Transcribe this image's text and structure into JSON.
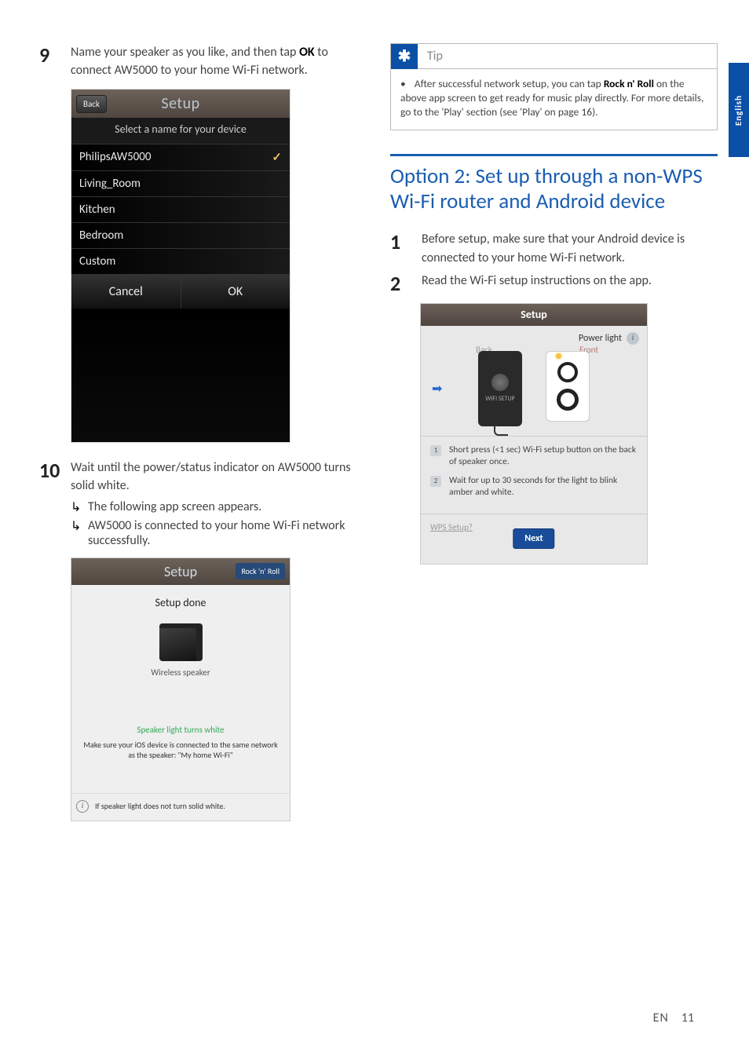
{
  "langTab": "English",
  "footer": {
    "lang": "EN",
    "page": "11"
  },
  "left": {
    "step9": {
      "num": "9",
      "text_a": "Name your speaker as you like, and then tap ",
      "text_bold": "OK",
      "text_b": " to connect AW5000 to your home Wi-Fi network."
    },
    "mock1": {
      "back": "Back",
      "title": "Setup",
      "subhead": "Select a name for your device",
      "rows": [
        "PhilipsAW5000",
        "Living_Room",
        "Kitchen",
        "Bedroom",
        "Custom"
      ],
      "checked_index": 0,
      "cancel": "Cancel",
      "ok": "OK"
    },
    "step10": {
      "num": "10",
      "text": "Wait until the power/status indicator on AW5000 turns solid white.",
      "sub1": "The following app screen appears.",
      "sub2": "AW5000 is connected to your home Wi-Fi network successfully."
    },
    "mock2": {
      "title": "Setup",
      "roll": "Rock 'n' Roll",
      "done": "Setup done",
      "label": "Wireless speaker",
      "white": "Speaker light turns white",
      "note": "Make sure your iOS device is connected to the same network as the speaker:  \"My home Wi-Fi\"",
      "info": "If speaker light does not turn solid white."
    }
  },
  "right": {
    "tip": {
      "label": "Tip",
      "body_a": "After successful network setup, you can tap ",
      "body_bold": "Rock n' Roll",
      "body_b": " on the above app screen to get ready for music play directly. For more details, go to the 'Play' section (see 'Play' on page 16)."
    },
    "heading": "Option 2: Set up through a non-WPS Wi-Fi router and Android device",
    "step1": {
      "num": "1",
      "text": "Before setup, make sure that your Android device is connected to your home Wi-Fi network."
    },
    "step2": {
      "num": "2",
      "text": "Read the Wi-Fi setup instructions on the app."
    },
    "mock3": {
      "title": "Setup",
      "power": "Power light",
      "back": "Back",
      "front": "Front",
      "wifi": "WIFI SETUP",
      "li1": "Short press (<1 sec) Wi-Fi setup button on the back of speaker once.",
      "li2": "Wait for up to 30 seconds for the light to blink amber and white.",
      "wps": "WPS Setup?",
      "next": "Next"
    }
  }
}
